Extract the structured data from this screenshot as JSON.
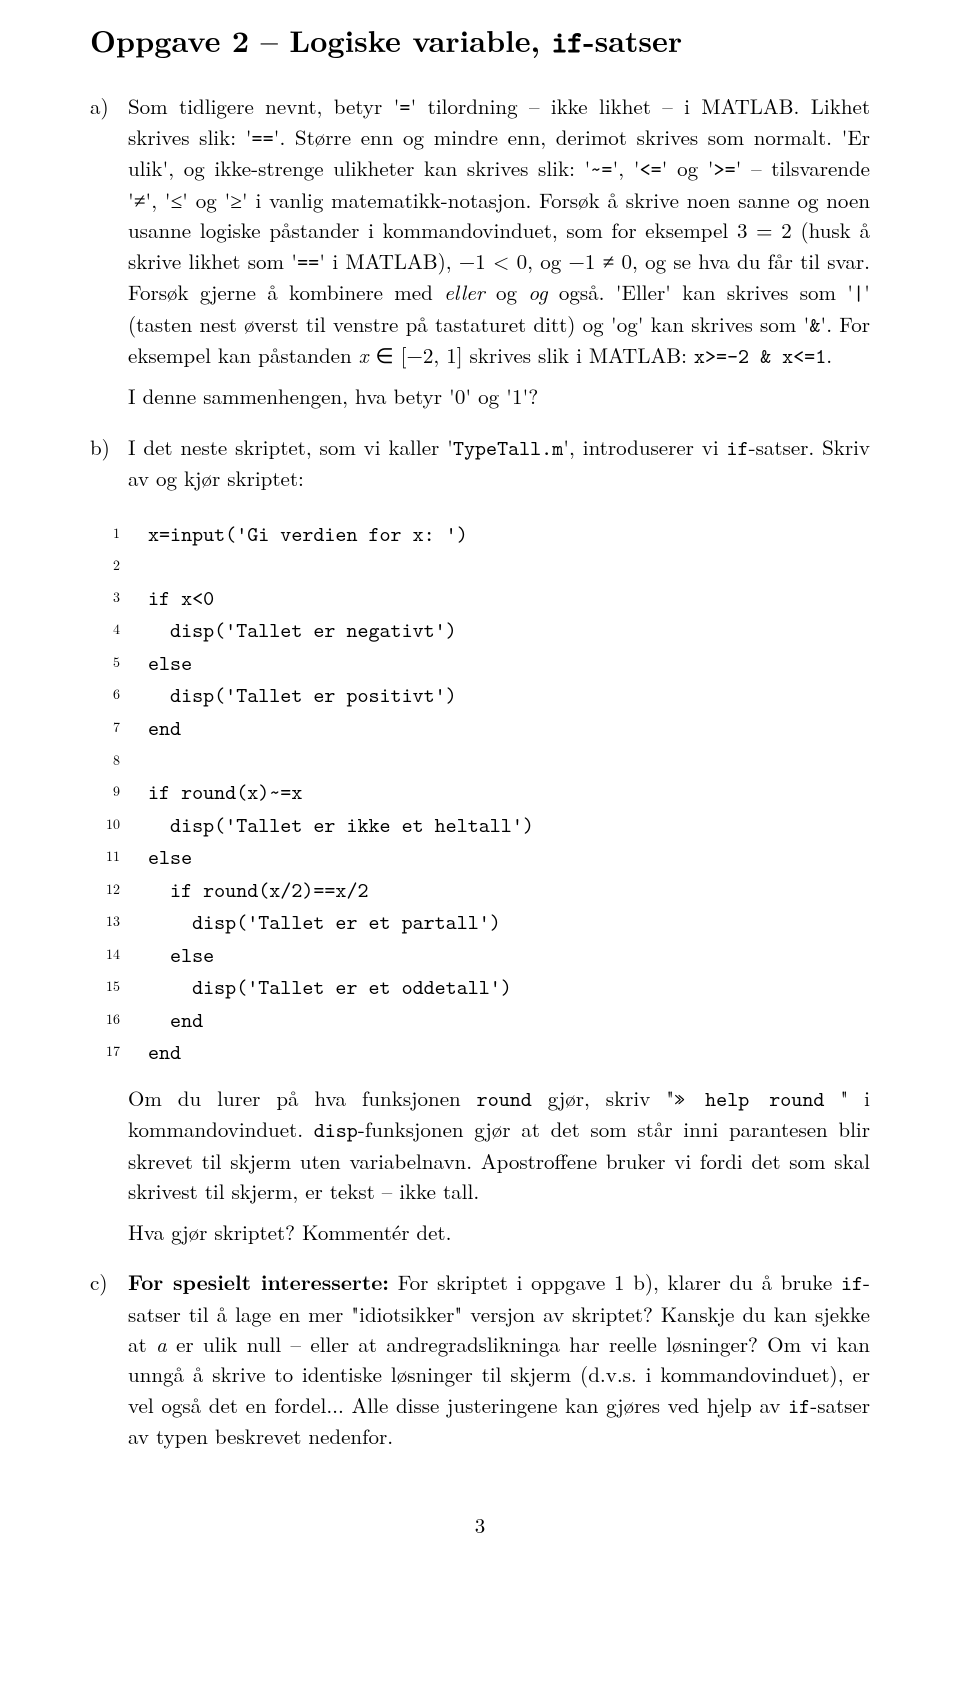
{
  "title_prefix": "Oppgave 2 – Logiske variable, ",
  "title_suffix": "-satser",
  "title_tt": "if",
  "items": {
    "a": {
      "label": "a)",
      "p1_parts": [
        "Som tidligere nevnt, betyr '",
        "=",
        "' tilordning – ikke likhet – i MATLAB. Likhet skrives slik: '",
        "==",
        "'. Større enn og mindre enn, derimot skrives som normalt. 'Er ulik', og ikke-strenge ulikheter kan skrives slik: '",
        "~=",
        "', '",
        "<=",
        "' og '",
        ">=",
        "' – tilsvarende '≠', '≤' og '≥' i vanlig matematikk-notasjon. Forsøk å skrive noen sanne og noen usanne logiske påstander i kommandovinduet, som for eksempel 3 = 2 (husk å skrive likhet som '",
        "==",
        "' i MATLAB), −1 < 0, og −1 ≠ 0, og se hva du får til svar. Forsøk gjerne å kombinere med ",
        "eller",
        " og ",
        "og",
        " også. 'Eller' kan skrives som '",
        "|",
        "' (tasten nest øverst til venstre på tastaturet ditt) og 'og' kan skrives som '",
        "&",
        "'. For eksempel kan påstanden ",
        "x",
        " ∈ [−2, 1] skrives slik i MATLAB: ",
        "x>=-2 & x<=1",
        "."
      ],
      "p2": "I denne sammenhengen, hva betyr '0' og '1'?"
    },
    "b": {
      "label": "b)",
      "p1_parts": [
        "I det neste skriptet, som vi kaller '",
        "TypeTall.m",
        "', introduserer vi ",
        "if",
        "-satser. Skriv av og kjør skriptet:"
      ],
      "p2_parts": [
        "Om du lurer på hva funksjonen ",
        "round",
        " gjør, skriv \"",
        "» help round",
        " \" i kommandovinduet. ",
        "disp",
        "-funksjonen gjør at det som står inni parantesen blir skrevet til skjerm uten variabelnavn. Apostroffene bruker vi fordi det som skal skrivest til skjerm, er tekst – ikke tall."
      ],
      "p3": "Hva gjør skriptet? Kommentér det."
    },
    "c": {
      "label": "c)",
      "p1_parts": [
        "For spesielt interesserte:",
        " For skriptet i oppgave 1 b), klarer du å bruke ",
        "if",
        "-satser til å lage en mer \"idiotsikker\" versjon av skriptet? Kanskje du kan sjekke at ",
        "a",
        " er ulik null – eller at andregradslikninga har reelle løsninger? Om vi kan unngå å skrive to identiske løsninger til skjerm (d.v.s. i kommandovinduet), er vel også det en fordel... Alle disse justeringene kan gjøres ved hjelp av ",
        "if",
        "-satser av typen beskrevet nedenfor."
      ]
    }
  },
  "code": [
    {
      "n": "1",
      "t": "x=input('Gi verdien for x: ')"
    },
    {
      "n": "2",
      "t": ""
    },
    {
      "n": "3",
      "t": "if x<0"
    },
    {
      "n": "4",
      "t": "  disp('Tallet er negativt')"
    },
    {
      "n": "5",
      "t": "else"
    },
    {
      "n": "6",
      "t": "  disp('Tallet er positivt')"
    },
    {
      "n": "7",
      "t": "end"
    },
    {
      "n": "8",
      "t": ""
    },
    {
      "n": "9",
      "t": "if round(x)~=x"
    },
    {
      "n": "10",
      "t": "  disp('Tallet er ikke et heltall')"
    },
    {
      "n": "11",
      "t": "else"
    },
    {
      "n": "12",
      "t": "  if round(x/2)==x/2"
    },
    {
      "n": "13",
      "t": "    disp('Tallet er et partall')"
    },
    {
      "n": "14",
      "t": "  else"
    },
    {
      "n": "15",
      "t": "    disp('Tallet er et oddetall')"
    },
    {
      "n": "16",
      "t": "  end"
    },
    {
      "n": "17",
      "t": "end"
    }
  ],
  "page_number": "3"
}
